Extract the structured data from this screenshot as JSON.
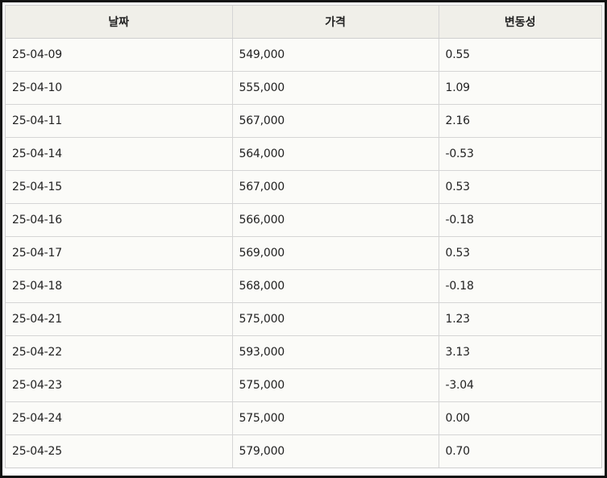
{
  "table": {
    "headers": [
      "날짜",
      "가격",
      "변동성"
    ],
    "rows": [
      [
        "25-04-09",
        "549,000",
        "0.55"
      ],
      [
        "25-04-10",
        "555,000",
        "1.09"
      ],
      [
        "25-04-11",
        "567,000",
        "2.16"
      ],
      [
        "25-04-14",
        "564,000",
        "-0.53"
      ],
      [
        "25-04-15",
        "567,000",
        "0.53"
      ],
      [
        "25-04-16",
        "566,000",
        "-0.18"
      ],
      [
        "25-04-17",
        "569,000",
        "0.53"
      ],
      [
        "25-04-18",
        "568,000",
        "-0.18"
      ],
      [
        "25-04-21",
        "575,000",
        "1.23"
      ],
      [
        "25-04-22",
        "593,000",
        "3.13"
      ],
      [
        "25-04-23",
        "575,000",
        "-3.04"
      ],
      [
        "25-04-24",
        "575,000",
        "0.00"
      ],
      [
        "25-04-25",
        "579,000",
        "0.70"
      ]
    ]
  },
  "colors": {
    "header_background": "#f0efe9",
    "table_background": "#fbfbf8",
    "border": "#d5d5d5",
    "frame": "#111111"
  }
}
